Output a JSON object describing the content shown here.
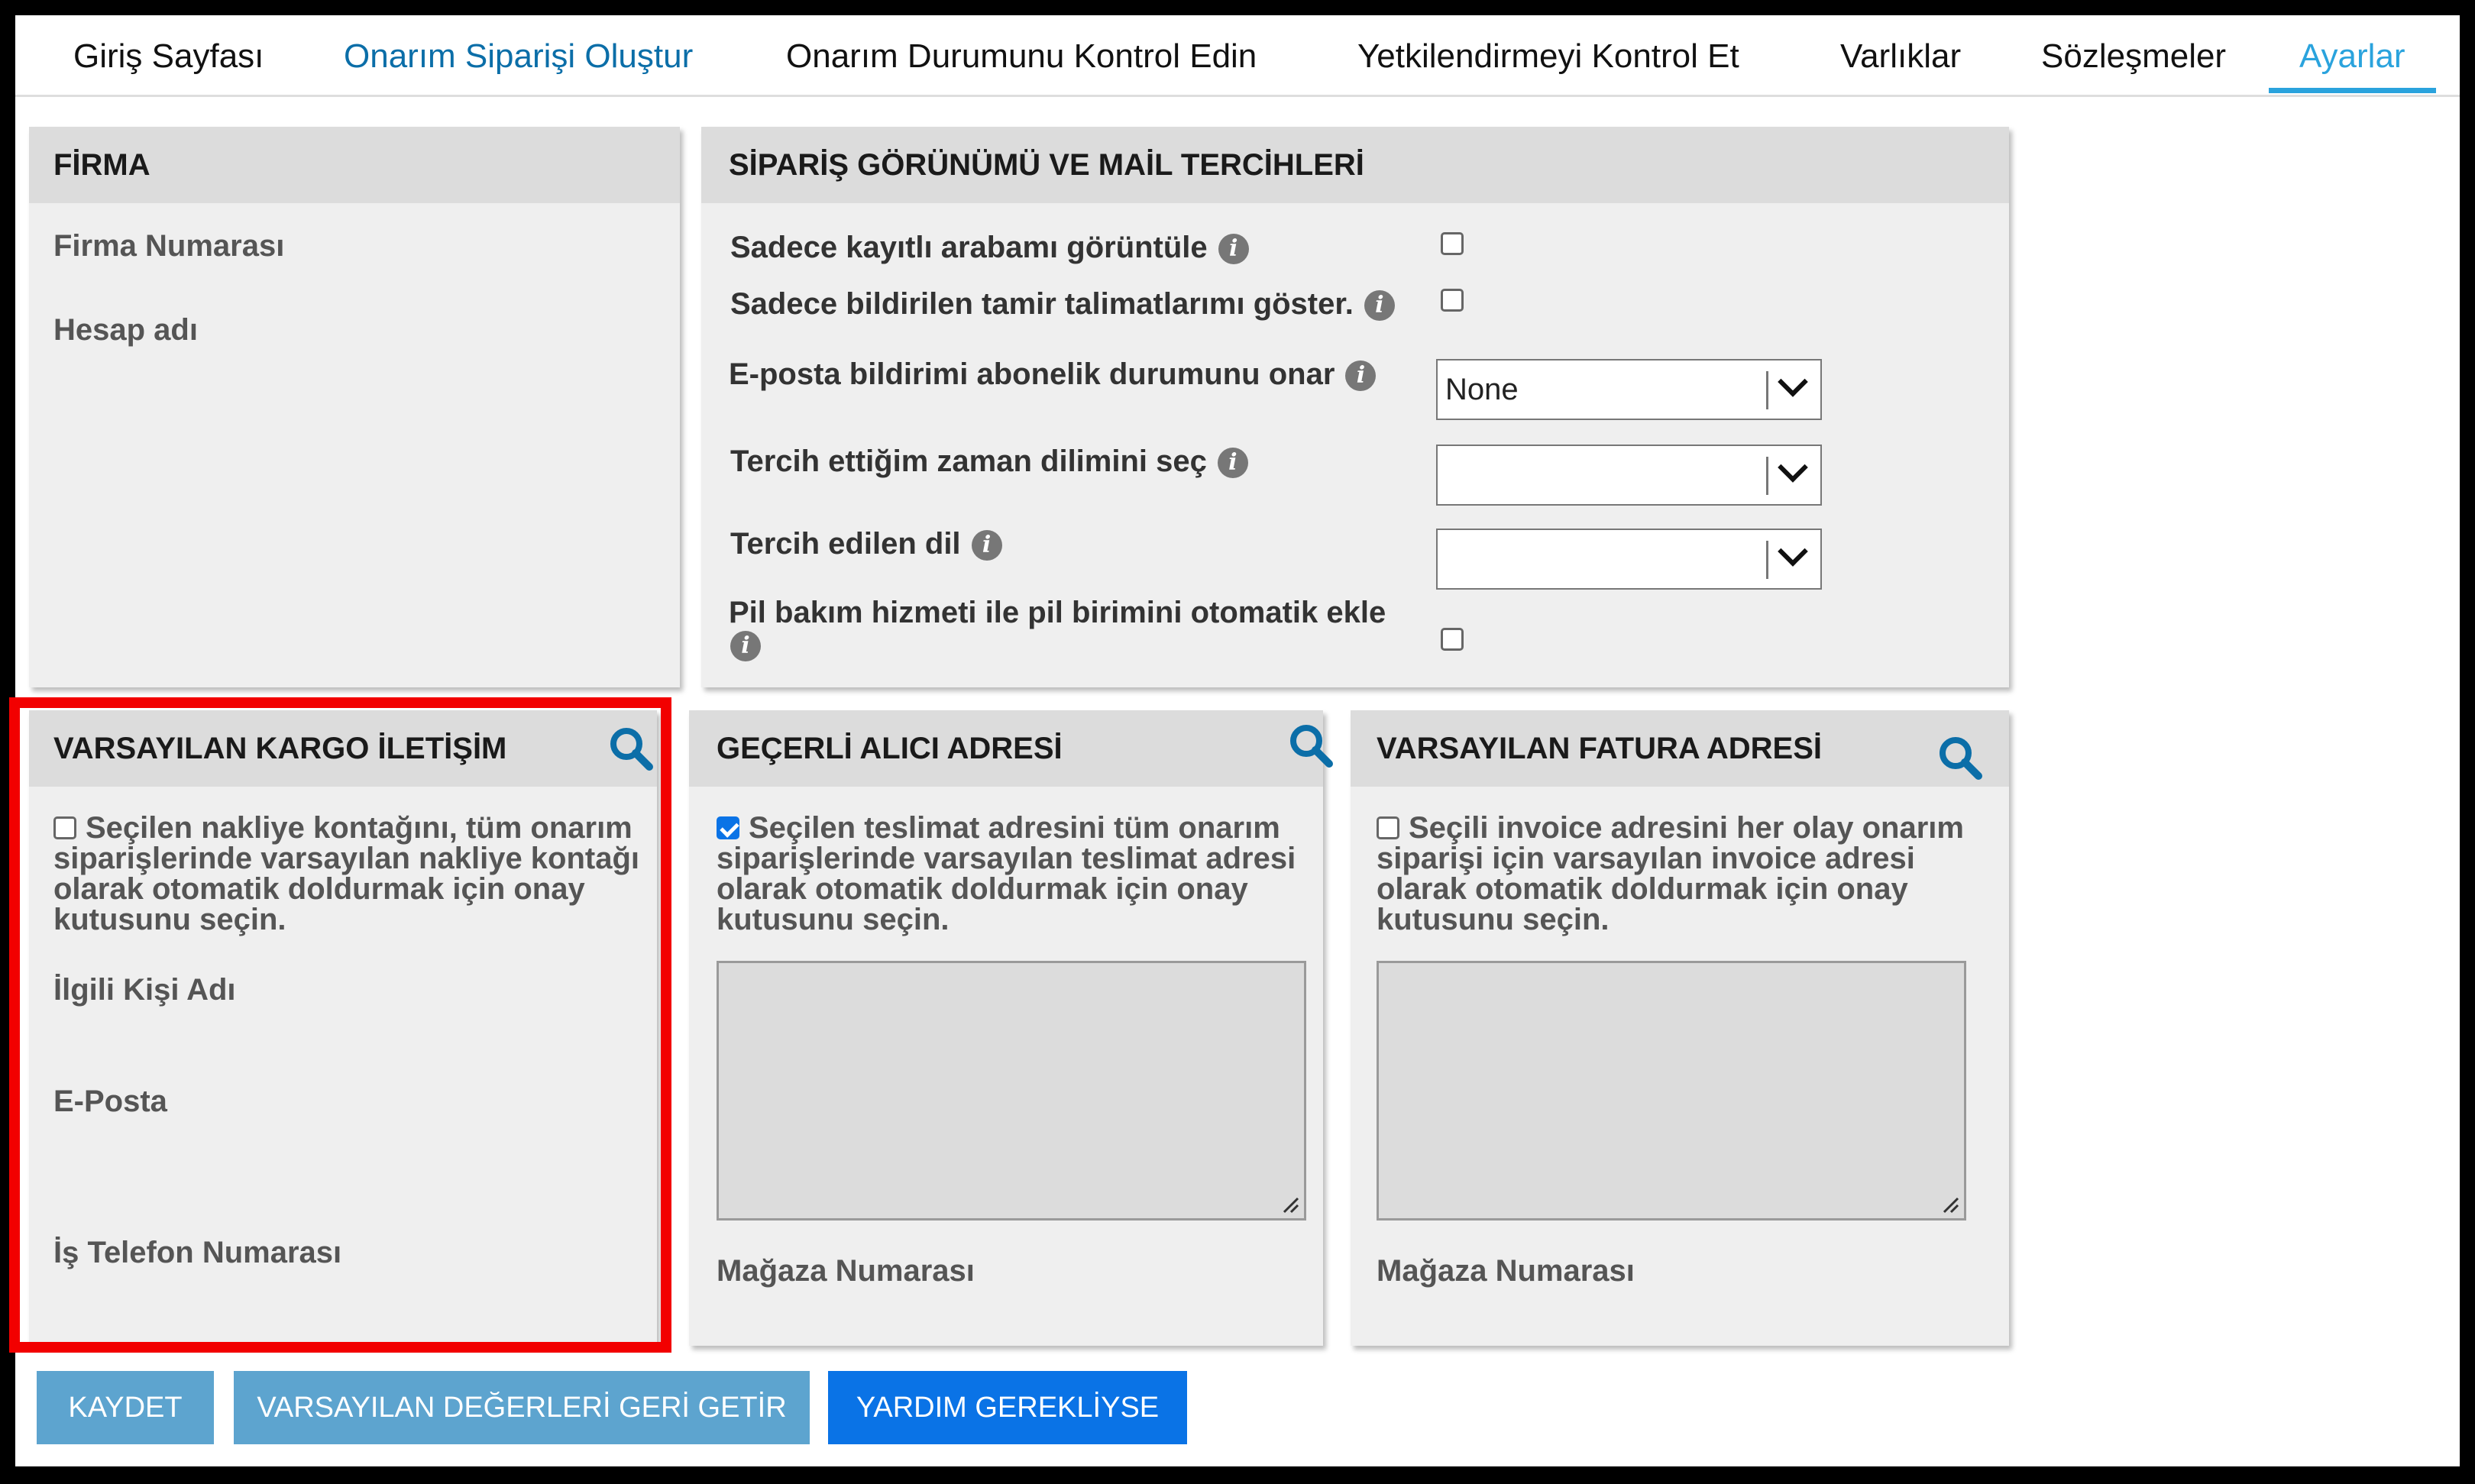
{
  "nav": {
    "tabs": [
      {
        "label": "Giriş Sayfası"
      },
      {
        "label": "Onarım Siparişi Oluştur"
      },
      {
        "label": "Onarım Durumunu Kontrol Edin"
      },
      {
        "label": "Yetkilendirmeyi Kontrol Et"
      },
      {
        "label": "Varlıklar"
      },
      {
        "label": "Sözleşmeler"
      },
      {
        "label": "Ayarlar"
      }
    ],
    "active_tab": "Ayarlar"
  },
  "firma": {
    "title": "FİRMA",
    "firma_numarasi": "Firma Numarası",
    "hesap_adi": "Hesap adı"
  },
  "siparis": {
    "title": "SİPARİŞ GÖRÜNÜMÜ VE MAİL TERCİHLERİ",
    "only_registered_car": {
      "label": "Sadece kayıtlı arabamı görüntüle",
      "checked": false
    },
    "only_reported_instructions": {
      "label": "Sadece bildirilen tamir talimatlarımı göster.",
      "checked": false
    },
    "email_subscription": {
      "label": "E-posta bildirimi abonelik durumunu onar",
      "value": "None"
    },
    "timezone": {
      "label": "Tercih ettiğim zaman dilimini seç",
      "value": ""
    },
    "language": {
      "label": "Tercih edilen dil",
      "value": ""
    },
    "battery": {
      "label": "Pil bakım hizmeti ile pil birimini otomatik ekle",
      "checked": false
    }
  },
  "kargo": {
    "title": "VARSAYILAN KARGO İLETİŞİM",
    "desc": "Seçilen nakliye kontağını, tüm onarım siparişlerinde varsayılan nakliye kontağı olarak otomatik doldurmak için onay kutusunu seçin.",
    "checked": false,
    "ilgili_kisi": "İlgili Kişi Adı",
    "eposta": "E-Posta",
    "telefon": "İş Telefon Numarası"
  },
  "alici": {
    "title": "GEÇERLİ ALICI ADRESİ",
    "desc": "Seçilen teslimat adresini tüm onarım siparişlerinde varsayılan teslimat adresi olarak otomatik doldurmak için onay kutusunu seçin.",
    "checked": true,
    "address": "",
    "magaza": "Mağaza Numarası"
  },
  "fatura": {
    "title": "VARSAYILAN FATURA ADRESİ",
    "desc": "Seçili invoice adresini her olay onarım siparişi için varsayılan invoice adresi olarak otomatik doldurmak için onay kutusunu seçin.",
    "checked": false,
    "address": "",
    "magaza": "Mağaza Numarası"
  },
  "buttons": {
    "save": "KAYDET",
    "restore": "VARSAYILAN DEĞERLERİ GERİ GETİR",
    "help": "YARDIM GEREKLİYSE"
  },
  "colors": {
    "accent": "#2aa3dd",
    "link": "#0b6ea8",
    "primary_button": "#0a73e6",
    "muted_button": "#5da4cf",
    "highlight": "#f20000"
  },
  "icons": {
    "search": "search-icon",
    "info": "info-icon"
  }
}
